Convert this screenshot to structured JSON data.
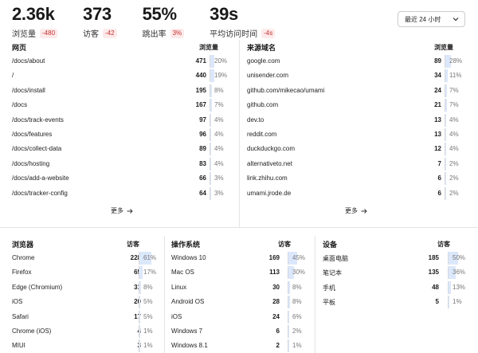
{
  "metrics": [
    {
      "value": "2.36k",
      "label": "浏览量",
      "change": "-480"
    },
    {
      "value": "373",
      "label": "访客",
      "change": "-42"
    },
    {
      "value": "55%",
      "label": "跳出率",
      "change": "3%"
    },
    {
      "value": "39s",
      "label": "平均访问时间",
      "change": "-4s"
    }
  ],
  "range": {
    "selected": "最近 24 小时",
    "icon": "chevron-down-icon"
  },
  "pages": {
    "title": "网页",
    "metric": "浏览量",
    "more": "更多",
    "rows": [
      {
        "name": "/docs/about",
        "value": "471",
        "pct": "20%",
        "fill": 0.2
      },
      {
        "name": "/",
        "value": "440",
        "pct": "19%",
        "fill": 0.19
      },
      {
        "name": "/docs/install",
        "value": "195",
        "pct": "8%",
        "fill": 0.08
      },
      {
        "name": "/docs",
        "value": "167",
        "pct": "7%",
        "fill": 0.07
      },
      {
        "name": "/docs/track-events",
        "value": "97",
        "pct": "4%",
        "fill": 0.04
      },
      {
        "name": "/docs/features",
        "value": "96",
        "pct": "4%",
        "fill": 0.04
      },
      {
        "name": "/docs/collect-data",
        "value": "89",
        "pct": "4%",
        "fill": 0.04
      },
      {
        "name": "/docs/hosting",
        "value": "83",
        "pct": "4%",
        "fill": 0.04
      },
      {
        "name": "/docs/add-a-website",
        "value": "66",
        "pct": "3%",
        "fill": 0.03
      },
      {
        "name": "/docs/tracker-config",
        "value": "64",
        "pct": "3%",
        "fill": 0.03
      }
    ]
  },
  "referrers": {
    "title": "来源域名",
    "metric": "浏览量",
    "more": "更多",
    "rows": [
      {
        "name": "google.com",
        "value": "89",
        "pct": "28%",
        "fill": 0.28
      },
      {
        "name": "unisender.com",
        "value": "34",
        "pct": "11%",
        "fill": 0.11
      },
      {
        "name": "github.com/mikecao/umami",
        "value": "24",
        "pct": "7%",
        "fill": 0.07
      },
      {
        "name": "github.com",
        "value": "21",
        "pct": "7%",
        "fill": 0.07
      },
      {
        "name": "dev.to",
        "value": "13",
        "pct": "4%",
        "fill": 0.04
      },
      {
        "name": "reddit.com",
        "value": "13",
        "pct": "4%",
        "fill": 0.04
      },
      {
        "name": "duckduckgo.com",
        "value": "12",
        "pct": "4%",
        "fill": 0.04
      },
      {
        "name": "alternativeto.net",
        "value": "7",
        "pct": "2%",
        "fill": 0.02
      },
      {
        "name": "link.zhihu.com",
        "value": "6",
        "pct": "2%",
        "fill": 0.02
      },
      {
        "name": "umami.jrode.de",
        "value": "6",
        "pct": "2%",
        "fill": 0.02
      }
    ]
  },
  "browsers": {
    "title": "浏览器",
    "metric": "访客",
    "rows": [
      {
        "name": "Chrome",
        "value": "228",
        "pct": "61%",
        "fill": 0.61
      },
      {
        "name": "Firefox",
        "value": "65",
        "pct": "17%",
        "fill": 0.17
      },
      {
        "name": "Edge (Chromium)",
        "value": "31",
        "pct": "8%",
        "fill": 0.08
      },
      {
        "name": "iOS",
        "value": "20",
        "pct": "5%",
        "fill": 0.05
      },
      {
        "name": "Safari",
        "value": "17",
        "pct": "5%",
        "fill": 0.05
      },
      {
        "name": "Chrome (iOS)",
        "value": "4",
        "pct": "1%",
        "fill": 0.01
      },
      {
        "name": "MIUI",
        "value": "3",
        "pct": "1%",
        "fill": 0.01
      }
    ]
  },
  "os": {
    "title": "操作系统",
    "metric": "访客",
    "rows": [
      {
        "name": "Windows 10",
        "value": "169",
        "pct": "45%",
        "fill": 0.45
      },
      {
        "name": "Mac OS",
        "value": "113",
        "pct": "30%",
        "fill": 0.3
      },
      {
        "name": "Linux",
        "value": "30",
        "pct": "8%",
        "fill": 0.08
      },
      {
        "name": "Android OS",
        "value": "28",
        "pct": "8%",
        "fill": 0.08
      },
      {
        "name": "iOS",
        "value": "24",
        "pct": "6%",
        "fill": 0.06
      },
      {
        "name": "Windows 7",
        "value": "6",
        "pct": "2%",
        "fill": 0.02
      },
      {
        "name": "Windows 8.1",
        "value": "2",
        "pct": "1%",
        "fill": 0.01
      }
    ]
  },
  "devices": {
    "title": "设备",
    "metric": "访客",
    "rows": [
      {
        "name": "桌面电脑",
        "value": "185",
        "pct": "50%",
        "fill": 0.5
      },
      {
        "name": "笔记本",
        "value": "135",
        "pct": "36%",
        "fill": 0.36
      },
      {
        "name": "手机",
        "value": "48",
        "pct": "13%",
        "fill": 0.13
      },
      {
        "name": "平板",
        "value": "5",
        "pct": "1%",
        "fill": 0.01
      }
    ]
  },
  "colors": {
    "bar_fill": "#dbe7fb",
    "bar_line": "#d9d9d9",
    "change_text": "#c52f2f",
    "change_bg": "#fdeaea"
  }
}
